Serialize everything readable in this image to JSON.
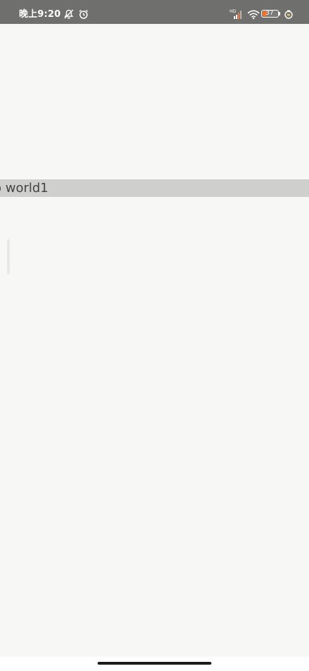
{
  "status_bar": {
    "time": "晚上9:20",
    "battery_level": "37",
    "icons": [
      "bell-off-icon",
      "alarm-icon",
      "hd-signal-icon",
      "wifi-icon",
      "battery-icon",
      "saver-icon"
    ]
  },
  "content": {
    "highlight_text": "o world1"
  },
  "colors": {
    "status_bar": "#6f706e",
    "background": "#f7f8f6",
    "highlight_bar": "#cfd0cd",
    "battery_fill": "#ff6d1f"
  }
}
